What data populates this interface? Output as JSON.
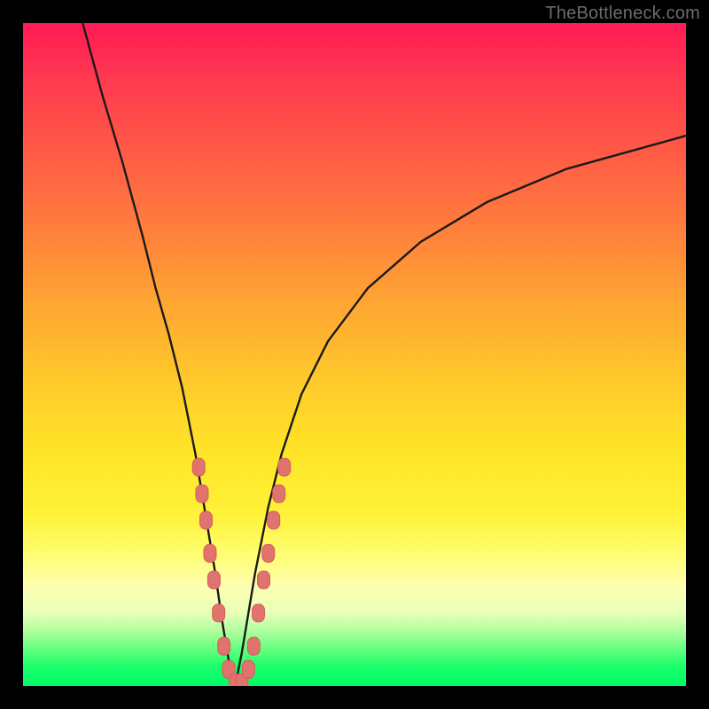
{
  "watermark": "TheBottleneck.com",
  "colors": {
    "frame": "#000000",
    "curve_stroke": "#1a1a1a",
    "marker_fill": "#e0736e",
    "marker_stroke": "#d65d58"
  },
  "chart_data": {
    "type": "line",
    "title": "",
    "xlabel": "",
    "ylabel": "",
    "xlim": [
      0,
      100
    ],
    "ylim": [
      0,
      100
    ],
    "grid": false,
    "legend": false,
    "note": "Bottleneck-style V-curve: y ≈ penalty/mismatch (0 = ideal, 100 = worst). Left branch falls steeply; right branch rises with diminishing slope. Values read from pixel positions on an unlabeled plot; they are proportional estimates, not labeled data.",
    "series": [
      {
        "name": "left-branch",
        "x": [
          9,
          12,
          15,
          18,
          20,
          22,
          24,
          26,
          27,
          28,
          29,
          30,
          31,
          32
        ],
        "y": [
          100,
          89,
          79,
          68,
          60,
          53,
          45,
          35,
          29,
          23,
          17,
          10,
          4,
          0
        ]
      },
      {
        "name": "right-branch",
        "x": [
          32,
          33,
          34,
          35,
          36,
          37,
          39,
          42,
          46,
          52,
          60,
          70,
          82,
          100
        ],
        "y": [
          0,
          5,
          11,
          17,
          22,
          27,
          35,
          44,
          52,
          60,
          67,
          73,
          78,
          83
        ]
      }
    ],
    "markers": {
      "name": "highlighted-points",
      "note": "Salmon-colored rounded markers clustered near the curve minimum on both branches.",
      "points": [
        {
          "x": 26.5,
          "y": 33
        },
        {
          "x": 27.0,
          "y": 29
        },
        {
          "x": 27.6,
          "y": 25
        },
        {
          "x": 28.2,
          "y": 20
        },
        {
          "x": 28.8,
          "y": 16
        },
        {
          "x": 29.5,
          "y": 11
        },
        {
          "x": 30.3,
          "y": 6
        },
        {
          "x": 31.0,
          "y": 2.5
        },
        {
          "x": 32.0,
          "y": 0.5
        },
        {
          "x": 33.0,
          "y": 0.5
        },
        {
          "x": 34.0,
          "y": 2.5
        },
        {
          "x": 34.8,
          "y": 6
        },
        {
          "x": 35.5,
          "y": 11
        },
        {
          "x": 36.3,
          "y": 16
        },
        {
          "x": 37.0,
          "y": 20
        },
        {
          "x": 37.8,
          "y": 25
        },
        {
          "x": 38.6,
          "y": 29
        },
        {
          "x": 39.4,
          "y": 33
        }
      ]
    }
  }
}
